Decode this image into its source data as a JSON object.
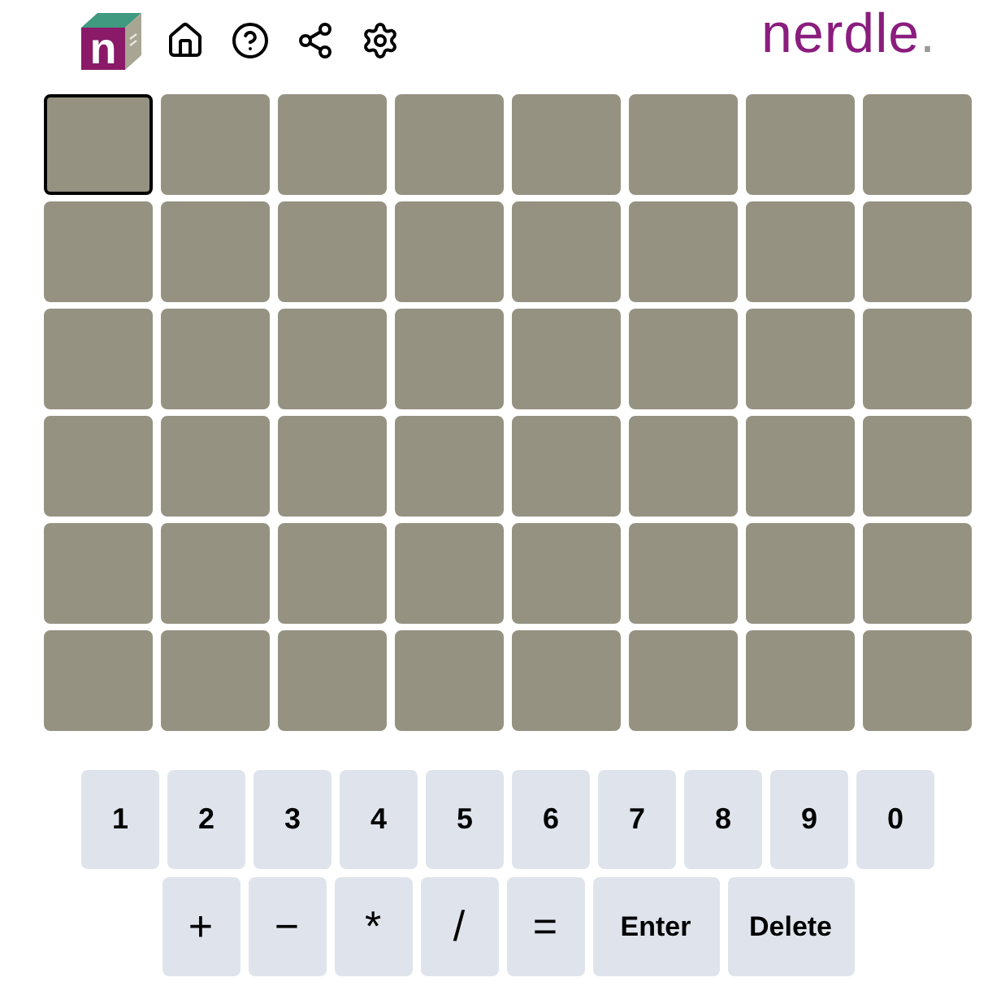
{
  "header": {
    "logo_letter": "n",
    "buttons": [
      {
        "kind": "home"
      },
      {
        "kind": "help"
      },
      {
        "kind": "share"
      },
      {
        "kind": "settings"
      }
    ],
    "wordmark": {
      "name": "nerdle",
      "dot": "."
    }
  },
  "board": {
    "rows": [
      {
        "tiles": [
          {
            "selected": true
          },
          {
            "selected": false
          },
          {
            "selected": false
          },
          {
            "selected": false
          },
          {
            "selected": false
          },
          {
            "selected": false
          },
          {
            "selected": false
          },
          {
            "selected": false
          }
        ]
      },
      {
        "tiles": [
          {
            "selected": false
          },
          {
            "selected": false
          },
          {
            "selected": false
          },
          {
            "selected": false
          },
          {
            "selected": false
          },
          {
            "selected": false
          },
          {
            "selected": false
          },
          {
            "selected": false
          }
        ]
      },
      {
        "tiles": [
          {
            "selected": false
          },
          {
            "selected": false
          },
          {
            "selected": false
          },
          {
            "selected": false
          },
          {
            "selected": false
          },
          {
            "selected": false
          },
          {
            "selected": false
          },
          {
            "selected": false
          }
        ]
      },
      {
        "tiles": [
          {
            "selected": false
          },
          {
            "selected": false
          },
          {
            "selected": false
          },
          {
            "selected": false
          },
          {
            "selected": false
          },
          {
            "selected": false
          },
          {
            "selected": false
          },
          {
            "selected": false
          }
        ]
      },
      {
        "tiles": [
          {
            "selected": false
          },
          {
            "selected": false
          },
          {
            "selected": false
          },
          {
            "selected": false
          },
          {
            "selected": false
          },
          {
            "selected": false
          },
          {
            "selected": false
          },
          {
            "selected": false
          }
        ]
      },
      {
        "tiles": [
          {
            "selected": false
          },
          {
            "selected": false
          },
          {
            "selected": false
          },
          {
            "selected": false
          },
          {
            "selected": false
          },
          {
            "selected": false
          },
          {
            "selected": false
          },
          {
            "selected": false
          }
        ]
      }
    ]
  },
  "keyboard": {
    "rows": [
      {
        "keys": [
          {
            "label": "1",
            "kind": "digit"
          },
          {
            "label": "2",
            "kind": "digit"
          },
          {
            "label": "3",
            "kind": "digit"
          },
          {
            "label": "4",
            "kind": "digit"
          },
          {
            "label": "5",
            "kind": "digit"
          },
          {
            "label": "6",
            "kind": "digit"
          },
          {
            "label": "7",
            "kind": "digit"
          },
          {
            "label": "8",
            "kind": "digit"
          },
          {
            "label": "9",
            "kind": "digit"
          },
          {
            "label": "0",
            "kind": "digit"
          }
        ]
      },
      {
        "keys": [
          {
            "label": "+",
            "kind": "operator"
          },
          {
            "label": "−",
            "kind": "operator"
          },
          {
            "label": "*",
            "kind": "operator"
          },
          {
            "label": "/",
            "kind": "operator"
          },
          {
            "label": "=",
            "kind": "operator"
          },
          {
            "label": "Enter",
            "kind": "action"
          },
          {
            "label": "Delete",
            "kind": "action"
          }
        ]
      }
    ]
  }
}
